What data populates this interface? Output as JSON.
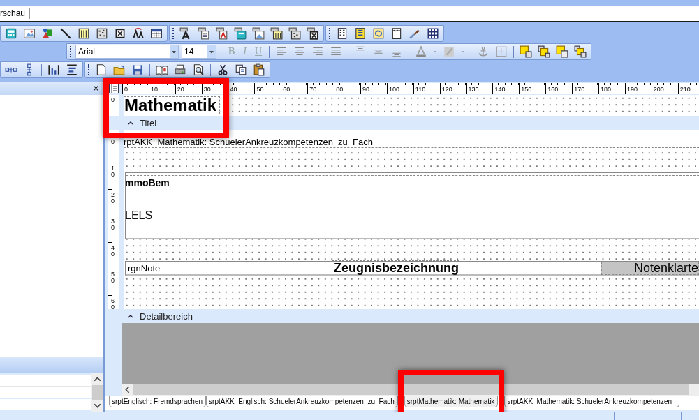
{
  "document_tab": {
    "label": "rschau"
  },
  "format_toolbar": {
    "font": "Arial",
    "size": "14",
    "style_buttons": [
      {
        "label": "B",
        "disabled": true
      },
      {
        "label": "I",
        "disabled": true
      },
      {
        "label": "U",
        "disabled": true
      }
    ]
  },
  "left_panel": {
    "close": "×"
  },
  "ruler": {
    "h_labels": [
      "0",
      "10",
      "20",
      "30",
      "40",
      "50",
      "60",
      "70",
      "80",
      "90",
      "100",
      "110",
      "120",
      "130",
      "140",
      "150",
      "160",
      "170",
      "180",
      "190",
      "200",
      "210"
    ],
    "v_labels_title": [
      "0"
    ],
    "v_labels_body": [
      "0",
      "10",
      "20",
      "30",
      "40",
      "50",
      "60"
    ]
  },
  "report": {
    "title_field": "Mathematik",
    "bands": [
      {
        "label": "Titel"
      },
      {
        "label": "Detailbereich"
      }
    ],
    "subreport_field": "rptAKK_Mathematik: SchuelerAnkreuzkompetenzen_zu_Fach",
    "memo_field": "mmoBem",
    "lels_field": "LELS",
    "note_region": {
      "label": "rgnNote",
      "title": "Zeugnisbezeichnung",
      "grade": "Notenklarte"
    }
  },
  "tabs": [
    {
      "label": "srptEnglisch: Fremdsprachen",
      "selected": false
    },
    {
      "label": "srptAKK_Englisch: SchuelerAnkreuzkompetenzen_zu_Fach",
      "selected": false
    },
    {
      "label": "srptMathematik: Mathematik",
      "selected": true
    },
    {
      "label": "srptAKK_Mathematik: SchuelerAnkreuzkompetenzen_",
      "selected": false
    }
  ]
}
